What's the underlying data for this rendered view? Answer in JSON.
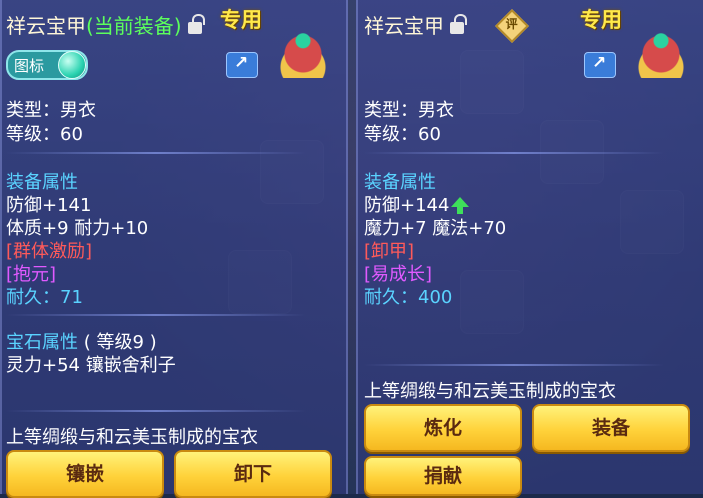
{
  "left_panel": {
    "item_name": "祥云宝甲",
    "equipped_tag": "(当前装备)",
    "special_tag": "专用",
    "icon_toggle_label": "图标",
    "type_line": "类型：男衣",
    "level_line": "等级：60",
    "equip_attr_title": "装备属性",
    "defense": "防御+141",
    "stats_line": "体质+9 耐力+10",
    "effect_1": "[群体激励]",
    "effect_2": "[抱元]",
    "durability": "耐久：71",
    "gem_attr_title": "宝石属性",
    "gem_level": "( 等级9 )",
    "gem_line": "灵力+54 镶嵌舍利子",
    "description": "上等绸缎与和云美玉制成的宝衣",
    "btn_inlay": "镶嵌",
    "btn_unequip": "卸下"
  },
  "right_panel": {
    "item_name": "祥云宝甲",
    "rating_badge": "评",
    "special_tag": "专用",
    "type_line": "类型：男衣",
    "level_line": "等级：60",
    "equip_attr_title": "装备属性",
    "defense": "防御+144",
    "stats_line": "魔力+7 魔法+70",
    "effect_1": "[卸甲]",
    "effect_2": "[易成长]",
    "durability": "耐久：400",
    "description": "上等绸缎与和云美玉制成的宝衣",
    "btn_refine": "炼化",
    "btn_equip": "装备",
    "btn_donate": "捐献"
  },
  "colors": {
    "accent_yellow": "#ffe94a",
    "attr_title": "#5ad3ff",
    "effect_red": "#ff5a5a",
    "effect_purple": "#e05aff",
    "upgrade_green": "#3ee05a"
  }
}
